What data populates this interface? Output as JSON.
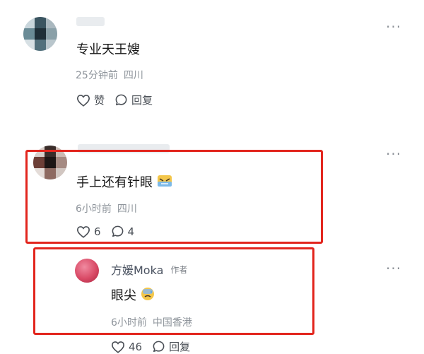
{
  "comments": [
    {
      "name": "",
      "text": "专业天王嫂",
      "time": "25分钟前",
      "location": "四川",
      "like_label": "赞",
      "reply_label": "回复",
      "more": "···"
    },
    {
      "name": "",
      "text": "手上还有针眼",
      "emoji": "face-with-bandage-emoji",
      "time": "6小时前",
      "location": "四川",
      "likes": "6",
      "replies": "4",
      "more": "···"
    }
  ],
  "reply": {
    "name": "方媛Moka",
    "author_tag": "作者",
    "text": "眼尖",
    "emoji": "sweat-emoji",
    "time": "6小时前",
    "location": "中国香港",
    "likes": "46",
    "reply_label": "回复",
    "more": "···"
  },
  "colors": {
    "highlight_box": "#e2251d",
    "meta_text": "#8e949b",
    "icon": "#4a4f56"
  }
}
